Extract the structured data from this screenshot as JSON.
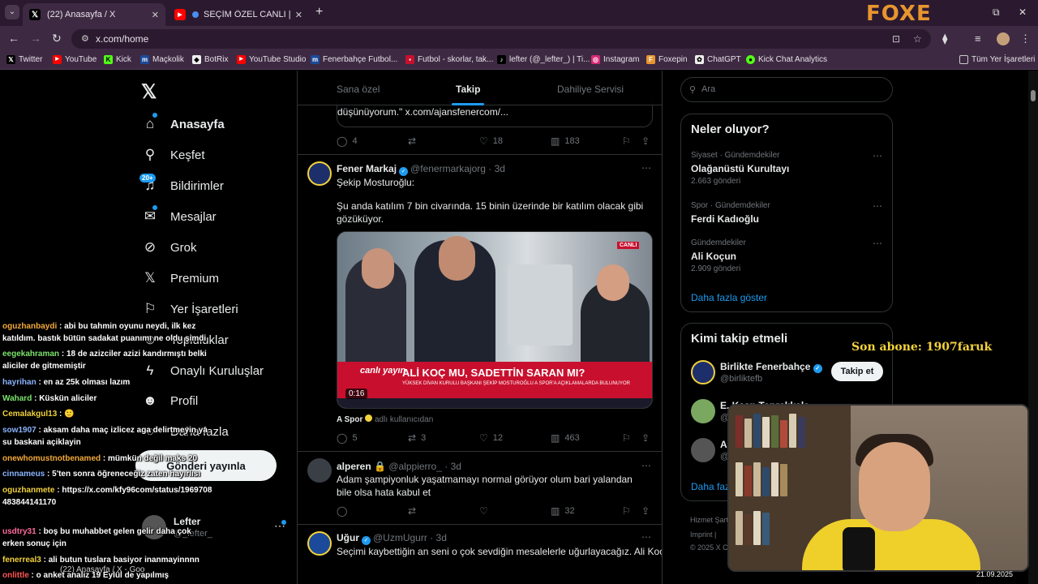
{
  "browser": {
    "tabs": [
      {
        "title": "(22) Anasayfa / X",
        "active": true
      },
      {
        "title": "SEÇİM ÖZEL CANLI | Kulübü",
        "active": false
      }
    ],
    "url": "x.com/home",
    "watermark": "FOXE",
    "bookmarks": [
      "Twitter",
      "YouTube",
      "Kick",
      "Maçkolik",
      "BotRix",
      "YouTube Studio",
      "Fenerbahçe Futbol...",
      "Futbol - skorlar, tak...",
      "lefter (@_lefter_) | Ti...",
      "Instagram",
      "Foxepin",
      "ChatGPT",
      "Kick Chat Analytics",
      "Tüm Yer İşaretleri"
    ]
  },
  "nav": {
    "items": [
      {
        "label": "Anasayfa",
        "icon": "home-icon"
      },
      {
        "label": "Keşfet",
        "icon": "search-icon"
      },
      {
        "label": "Bildirimler",
        "icon": "bell-icon"
      },
      {
        "label": "Mesajlar",
        "icon": "mail-icon"
      },
      {
        "label": "Grok",
        "icon": "grok-icon"
      },
      {
        "label": "Premium",
        "icon": "x-icon"
      },
      {
        "label": "Yer İşaretleri",
        "icon": "bookmark-icon"
      },
      {
        "label": "Topluluklar",
        "icon": "people-icon"
      },
      {
        "label": "Onaylı Kuruluşlar",
        "icon": "lightning-icon"
      },
      {
        "label": "Profil",
        "icon": "person-icon"
      },
      {
        "label": "Daha fazla",
        "icon": "more-circle-icon"
      }
    ],
    "notif_badge": "20+",
    "post_button": "Gönderi yayınla",
    "profile_name": "Lefter",
    "profile_handle": "@_lefter_"
  },
  "timeline": {
    "tabs": [
      "Sana özel",
      "Takip",
      "Dahiliye Servisi"
    ],
    "quote_tail": "düşünüyorum.\" x.com/ajansfenercom/...",
    "top_actions": {
      "replies": "4",
      "likes": "18",
      "views": "183"
    },
    "tweets": [
      {
        "name": "Fener Markaj",
        "handle": "@fenermarkajorg",
        "time": "3d",
        "text1": "Şekip Mosturoğlu:",
        "text2": "Şu anda katılım 7 bin civarında. 15 binin üzerinde bir katılım olacak gibi gözüküyor.",
        "media": {
          "headline": "ALİ KOÇ MU, SADETTİN SARAN MI?",
          "subline": "YÜKSEK DİVAN KURULU BAŞKANI ŞEKİP MOSTUROĞLU A SPOR'A AÇIKLAMALARDA BULUNUYOR",
          "logo": "canlı yayın",
          "live": "CANLI",
          "time": "0:16"
        },
        "source": "A Spor",
        "source_handle": "adlı kullanıcıdan",
        "replies": "5",
        "retweets": "3",
        "likes": "12",
        "views": "463"
      },
      {
        "name": "alperen",
        "handle": "@alppierro_",
        "time": "3d",
        "text1": "Adam şampiyonluk yaşatmamayı normal görüyor olum bari yalandan bile olsa hata kabul et",
        "views": "32"
      },
      {
        "name": "Uğur",
        "handle": "@UzmUgurr",
        "time": "3d",
        "text1": "Seçimi kaybettiğin an seni o çok sevdiğin mesalelerle uğurlayacağız. Ali Koç"
      }
    ]
  },
  "sidebar": {
    "search_placeholder": "Ara",
    "trends_title": "Neler oluyor?",
    "trends": [
      {
        "category": "Siyaset · Gündemdekiler",
        "name": "Olağanüstü Kurultayı",
        "count": "2.663 gönderi"
      },
      {
        "category": "Spor · Gündemdekiler",
        "name": "Ferdi Kadıoğlu",
        "count": ""
      },
      {
        "category": "Gündemdekiler",
        "name": "Ali Koçun",
        "count": "2.909 gönderi"
      }
    ],
    "show_more": "Daha fazla göster",
    "wtf_title": "Kimi takip etmeli",
    "who_to_follow": [
      {
        "name": "Birlikte Fenerbahçe",
        "handle": "@birliktefb",
        "button": "Takip et"
      },
      {
        "name": "E. Kaan Toprakkale",
        "handle": "@",
        "button": ""
      },
      {
        "name": "A",
        "handle": "@",
        "button": ""
      }
    ],
    "wtf_more": "Daha faz",
    "footer1": "Hizmet Şart",
    "footer2": "Imprint  |",
    "footer3": "© 2025 X C"
  },
  "overlay": {
    "son_abone": "Son abone: 1907faruk",
    "clock_date": "21.09.2025",
    "taskbar_text": "(22) Anasayfa / X - Goo",
    "chat": [
      {
        "user": "oguzhanbaydi",
        "color": "#f2a93b",
        "msg": "abi bu tahmin oyunu neydi, ilk kez katıldım. bastık bütün sadakat puanımı ne oldu şimdi"
      },
      {
        "user": "eegekahraman",
        "color": "#7be36c",
        "msg": "18 de azizciler azizi kandırmıştı belki aliciler de gitmemiştir"
      },
      {
        "user": "hayrihan",
        "color": "#8ab4ff",
        "msg": "en az 25k olması lazım"
      },
      {
        "user": "Wahard",
        "color": "#7be36c",
        "msg": "Küskün aliciler"
      },
      {
        "user": "Cemalakgul13",
        "color": "#f2d23c",
        "msg": "🙂"
      },
      {
        "user": "sow1907",
        "color": "#8ab4ff",
        "msg": "aksam daha maç izlicez aga delirtmeyin ya su baskani açiklayin"
      },
      {
        "user": "onewhomustnotbenamed",
        "color": "#f2a93b",
        "msg": "mümkün değil maks 20"
      },
      {
        "user": "cinnameus",
        "color": "#8ab4ff",
        "msg": "5'ten sonra öğreneceğiz zaten hayırlısı"
      },
      {
        "user": "oguzhanmete",
        "color": "#f2d23c",
        "msg": "https://x.com/kfy96com/status/1969708483844141170"
      },
      {
        "user": "usdtry31",
        "color": "#ff6b9a",
        "msg": "boş bu muhabbet gelen gelir daha çok erken sonuç için"
      },
      {
        "user": "fenerreal3",
        "color": "#f2d23c",
        "msg": "ali butun tuslara basiyor inanmayinnnn"
      },
      {
        "user": "onlittle",
        "color": "#ff5555",
        "msg": "o anket analiz 19 Eylül de yapılmış"
      }
    ]
  }
}
